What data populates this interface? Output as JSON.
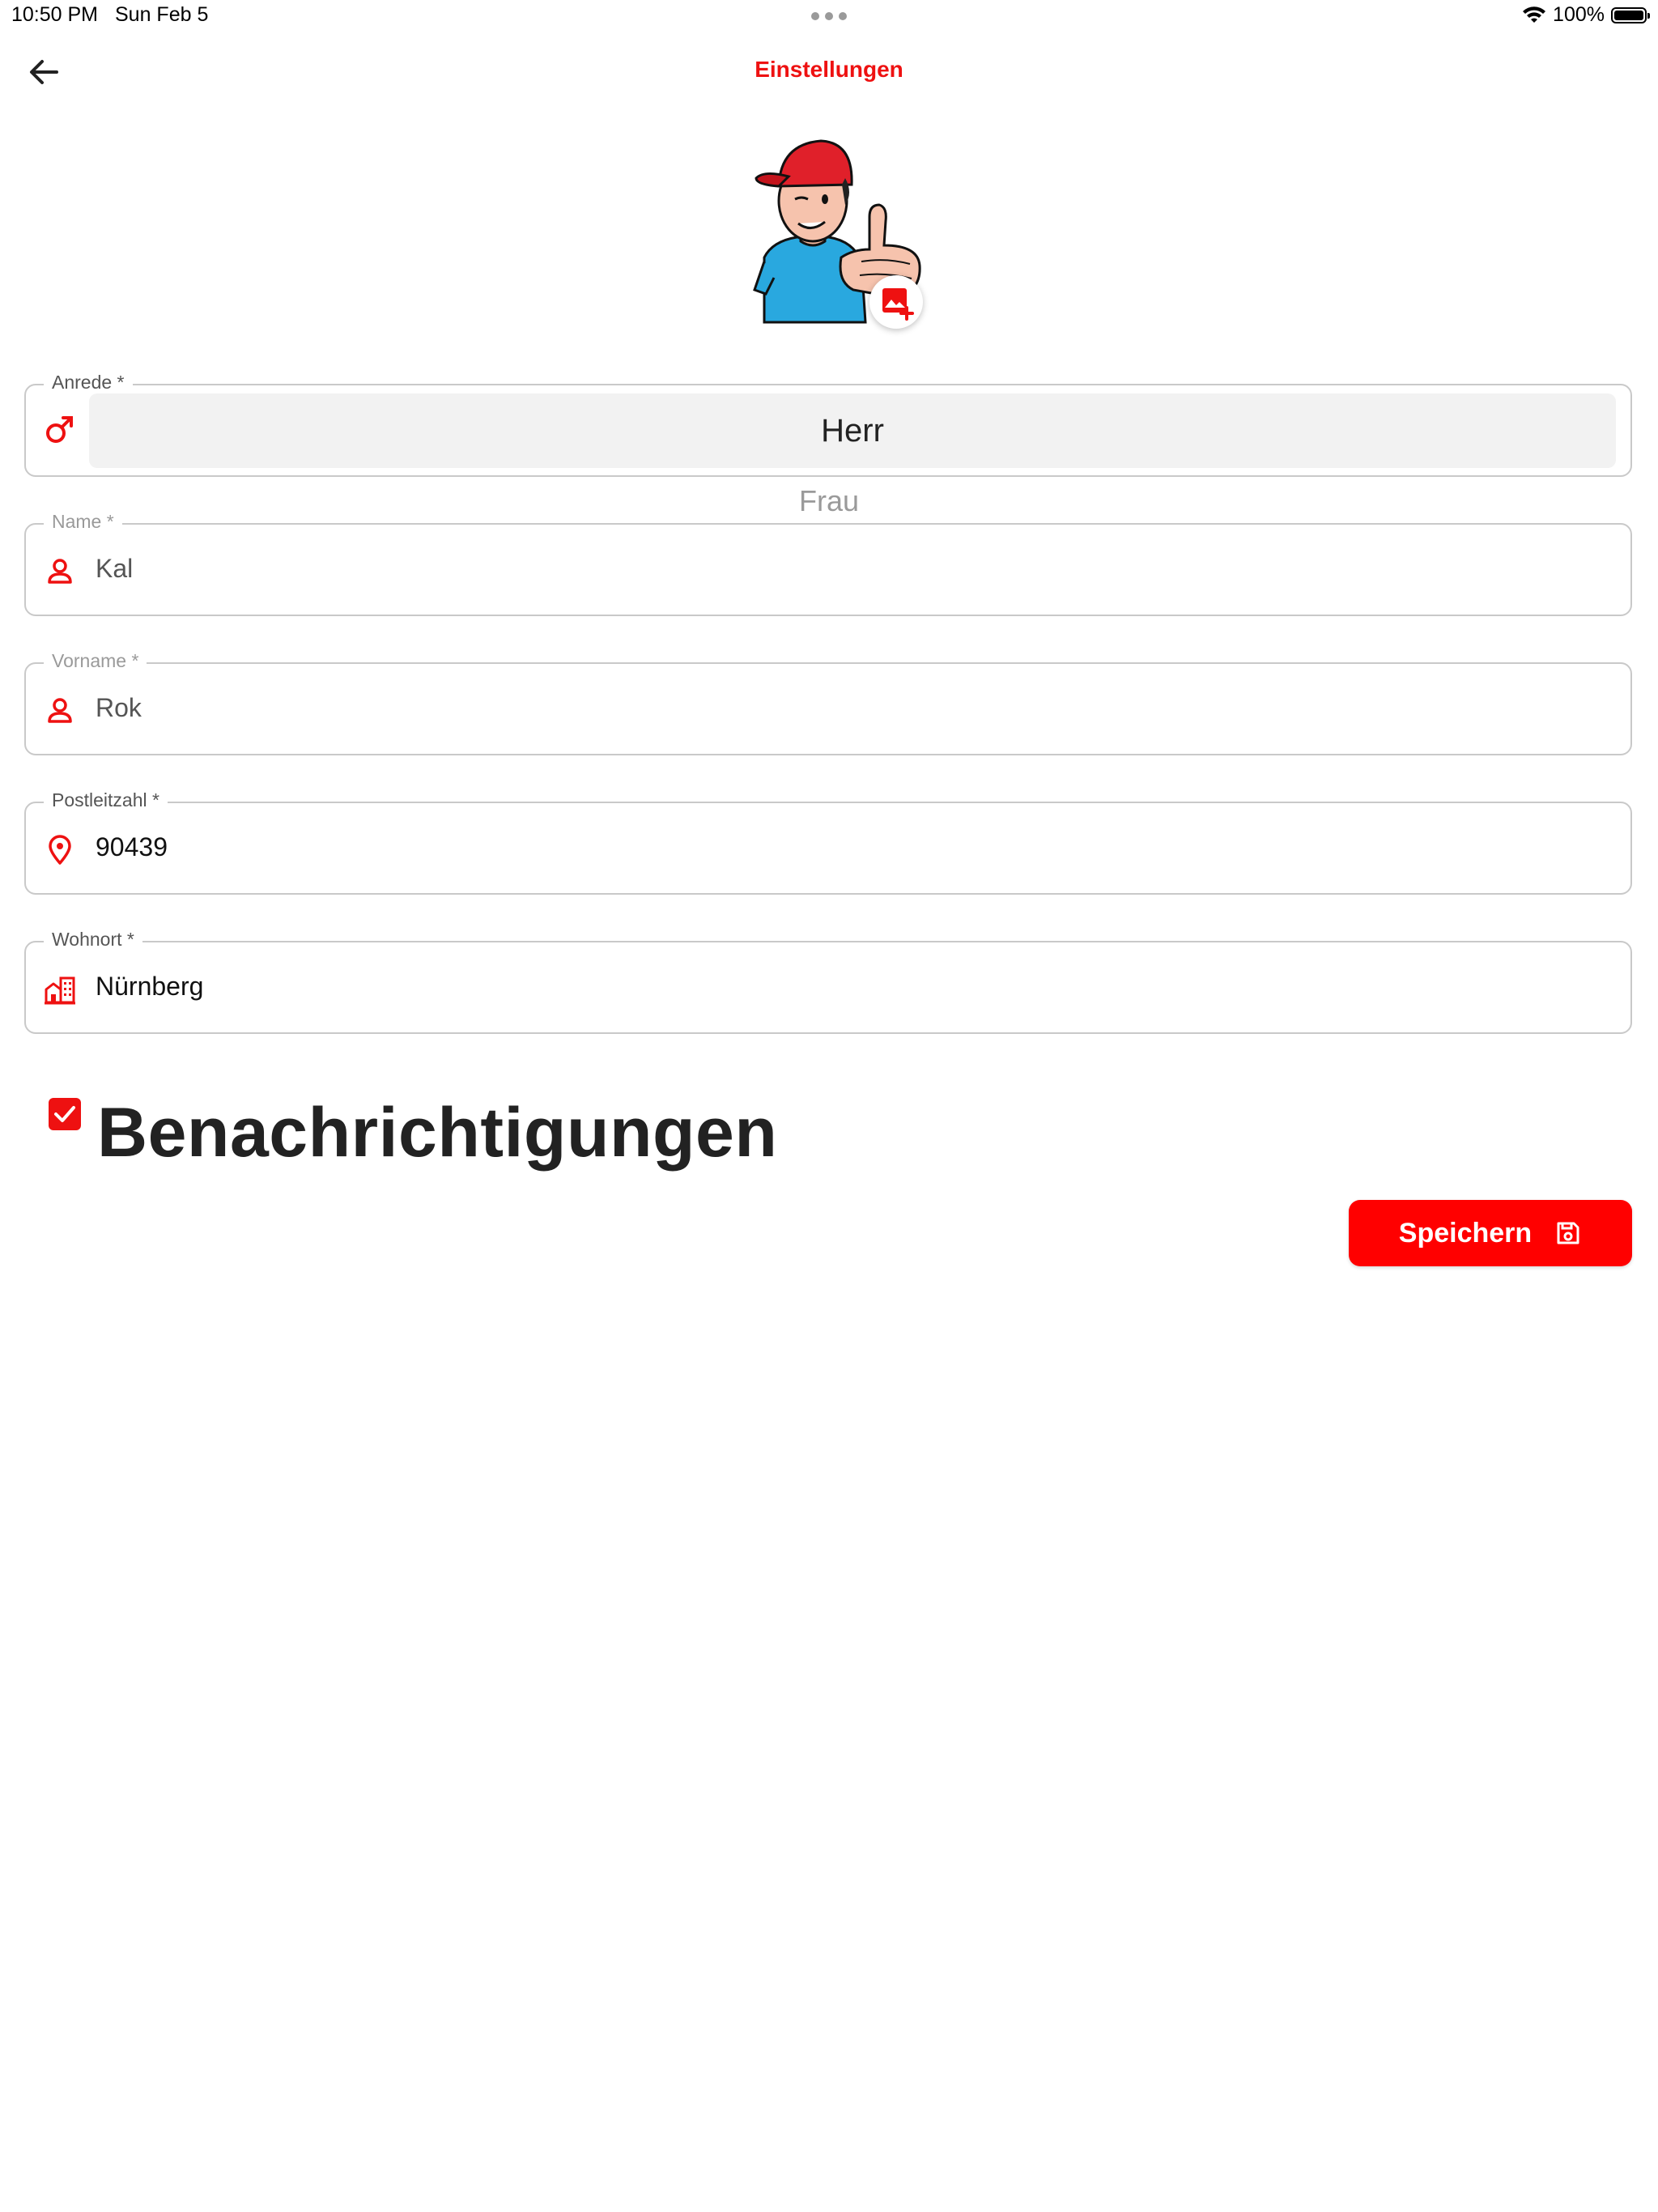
{
  "status_bar": {
    "time": "10:50 PM",
    "date": "Sun Feb 5",
    "battery": "100%"
  },
  "header": {
    "title": "Einstellungen",
    "back_icon": "arrow-left-icon"
  },
  "avatar": {
    "add_icon": "add-photo-icon"
  },
  "form": {
    "anrede": {
      "label": "Anrede *",
      "icon": "male-icon",
      "selected": "Herr",
      "next_option": "Frau"
    },
    "name": {
      "label": "Name *",
      "icon": "person-icon",
      "value": "Kal"
    },
    "vorname": {
      "label": "Vorname *",
      "icon": "person-icon",
      "value": "Rok"
    },
    "postleitzahl": {
      "label": "Postleitzahl *",
      "icon": "location-pin-icon",
      "value": "90439"
    },
    "wohnort": {
      "label": "Wohnort *",
      "icon": "city-icon",
      "value": "Nürnberg"
    }
  },
  "notifications": {
    "label": "Benachrichtigungen",
    "checked": true
  },
  "save_button": {
    "label": "Speichern",
    "icon": "save-icon"
  },
  "colors": {
    "accent": "#ee1111",
    "button": "#ff0000"
  }
}
